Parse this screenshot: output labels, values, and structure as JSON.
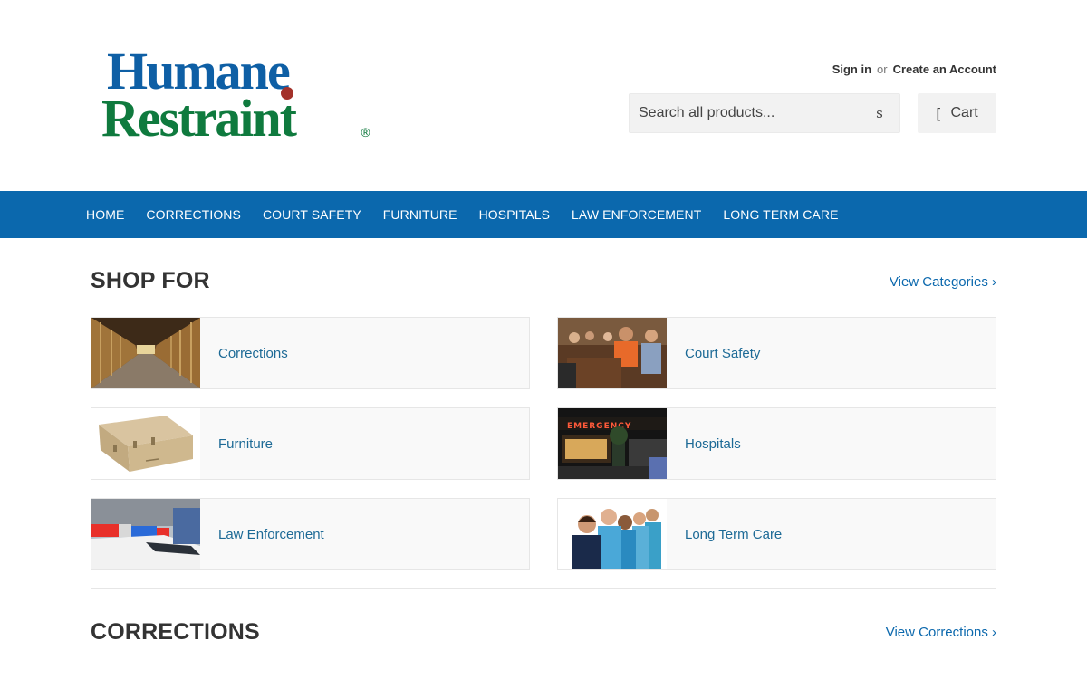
{
  "brand": {
    "logo_line1": "Humane",
    "logo_line2": "Restraint",
    "registered_mark": "®",
    "colors": {
      "blue": "#0e5fa5",
      "green": "#0f7a3e",
      "dot": "#a3312a"
    }
  },
  "account": {
    "sign_in": "Sign in",
    "or": "or",
    "create_account": "Create an Account"
  },
  "search": {
    "placeholder": "Search all products...",
    "button_glyph": "s",
    "icon": "search-icon"
  },
  "cart": {
    "glyph": "[",
    "label": "Cart",
    "icon": "cart-icon"
  },
  "nav": {
    "color": "#0b68ad",
    "items": [
      "HOME",
      "CORRECTIONS",
      "COURT SAFETY",
      "FURNITURE",
      "HOSPITALS",
      "LAW ENFORCEMENT",
      "LONG TERM CARE"
    ]
  },
  "shop_for": {
    "title": "SHOP FOR",
    "link": "View Categories ›",
    "categories": [
      {
        "label": "Corrections"
      },
      {
        "label": "Court Safety"
      },
      {
        "label": "Furniture"
      },
      {
        "label": "Hospitals"
      },
      {
        "label": "Law Enforcement"
      },
      {
        "label": "Long Term Care"
      }
    ]
  },
  "hospital_sign": "EMERGENCY",
  "corrections_section": {
    "title": "CORRECTIONS",
    "link": "View Corrections ›"
  }
}
